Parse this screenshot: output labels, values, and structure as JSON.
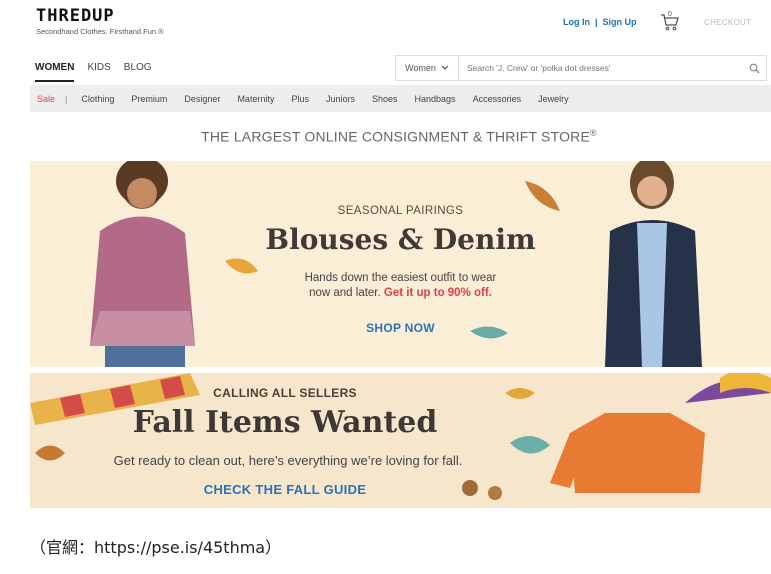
{
  "header": {
    "logo": "THREDUP",
    "logo_tagline": "Secondhand Clothes. Firsthand Fun.®",
    "login": "Log In",
    "separator": "|",
    "signup": "Sign Up",
    "cart_count": "0",
    "checkout": "CHECKOUT"
  },
  "main_nav": [
    "WOMEN",
    "KIDS",
    "BLOG"
  ],
  "search": {
    "category": "Women",
    "placeholder": "Search 'J. Crew' or 'polka dot dresses'"
  },
  "sub_nav": {
    "sale": "Sale",
    "pipe": "|",
    "items": [
      "Clothing",
      "Premium",
      "Designer",
      "Maternity",
      "Plus",
      "Juniors",
      "Shoes",
      "Handbags",
      "Accessories",
      "Jewelry"
    ]
  },
  "tagline": "THE LARGEST ONLINE CONSIGNMENT & THRIFT STORE",
  "tagline_mark": "®",
  "hero1": {
    "kicker": "SEASONAL PAIRINGS",
    "title": "Blouses & Denim",
    "body_line1": "Hands down the easiest outfit to wear",
    "body_line2": "now and later.",
    "promo": "Get it up to 90% off.",
    "cta": "SHOP NOW"
  },
  "hero2": {
    "kicker": "CALLING ALL SELLERS",
    "title": "Fall Items Wanted",
    "body": "Get ready to clean out, here’s everything we’re loving for fall.",
    "cta": "CHECK THE FALL GUIDE"
  },
  "footnote": "（官網：https://pse.is/45thma）",
  "colors": {
    "link_blue": "#1d6fb8",
    "sale_red": "#e2434d",
    "hero_bg": "#fbeed6"
  }
}
